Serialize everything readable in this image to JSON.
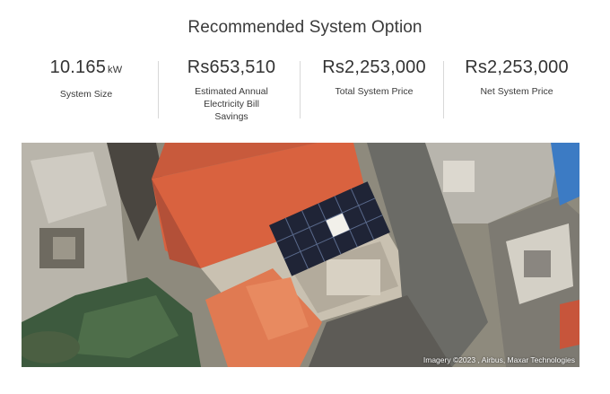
{
  "title": "Recommended System Option",
  "stats": [
    {
      "value": "10.165",
      "unit": "kW",
      "label": "System Size"
    },
    {
      "value": "Rs653,510",
      "unit": "",
      "label": "Estimated Annual Electricity Bill Savings"
    },
    {
      "value": "Rs2,253,000",
      "unit": "",
      "label": "Total System Price"
    },
    {
      "value": "Rs2,253,000",
      "unit": "",
      "label": "Net System Price"
    }
  ],
  "map": {
    "attribution": "Imagery ©2023 , Airbus, Maxar Technologies",
    "panel_color": "#1f2436",
    "roof_color": "#d9623f"
  }
}
